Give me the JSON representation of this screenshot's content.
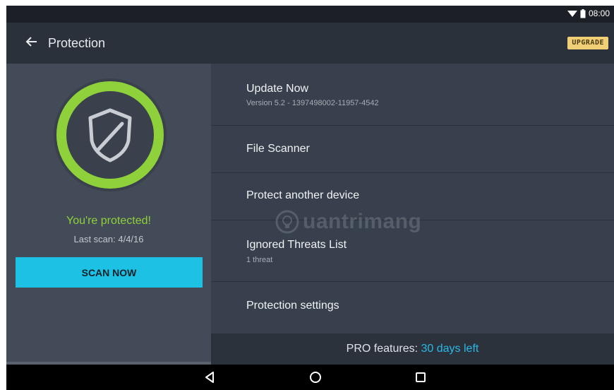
{
  "status": {
    "time": "08:00"
  },
  "appbar": {
    "title": "Protection",
    "upgrade_label": "UPGRADE"
  },
  "left_panel": {
    "status_text": "You're protected!",
    "last_scan": "Last scan: 4/4/16",
    "scan_button": "SCAN NOW"
  },
  "menu": {
    "items": [
      {
        "title": "Update Now",
        "subtitle": "Version 5.2 - 1397498002-11957-4542"
      },
      {
        "title": "File Scanner"
      },
      {
        "title": "Protect another device"
      },
      {
        "title": "Ignored Threats List",
        "subtitle": "1 threat"
      },
      {
        "title": "Protection settings"
      }
    ]
  },
  "footer": {
    "pro_label": "PRO features:",
    "days_left": "30 days left"
  },
  "watermark": {
    "text": "uantrimang"
  },
  "colors": {
    "accent_green": "#8fd13a",
    "accent_blue": "#2ab8e6",
    "scan_button": "#1cc1e4",
    "upgrade_badge": "#f1cf76"
  }
}
